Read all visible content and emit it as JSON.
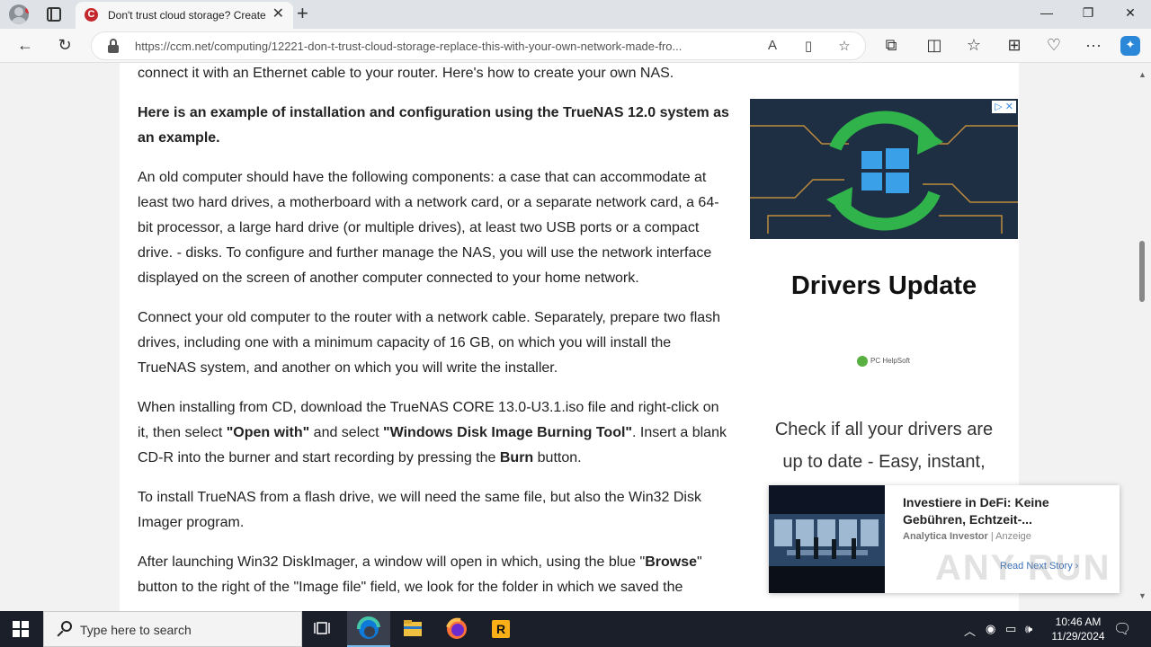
{
  "browser": {
    "tab_title": "Don't trust cloud storage? Create",
    "tab_favicon_letter": "C",
    "url": "https://ccm.net/computing/12221-don-t-trust-cloud-storage-replace-this-with-your-own-network-made-fro..."
  },
  "article": {
    "p0": "connect it with an Ethernet cable to your router. Here's how to create your own NAS.",
    "p1": "Here is an example of installation and configuration using the TrueNAS 12.0 system as an example.",
    "p2": "An old computer should have the following components: a case that can accommodate at least two hard drives, a motherboard with a network card, or a separate network card, a 64-bit processor, a large hard drive (or multiple drives), at least two USB ports or a compact drive. - disks. To configure and further manage the NAS, you will use the network interface displayed on the screen of another computer connected to your home network.",
    "p3": "Connect your old computer to the router with a network cable. Separately, prepare two flash drives, including one with a minimum capacity of 16 GB, on which you will install the TrueNAS system, and another on which you will write the installer.",
    "p4": {
      "a": "When installing from CD, download the TrueNAS CORE 13.0-U3.1.iso file and right-click on it, then select ",
      "b": "\"Open with\"",
      "c": " and select ",
      "d": "\"Windows Disk Image Burning Tool\"",
      "e": ". Insert a blank CD-R into the burner and start recording by pressing the ",
      "f": "Burn",
      "g": " button."
    },
    "p5": "To install TrueNAS from a flash drive, we will need the same file, but also the Win32 Disk Imager program.",
    "p6": {
      "a": "After launching Win32 DiskImager, a window will open in which, using the blue \"",
      "b": "Browse",
      "c": "\" button to the right of the \"Image file\" field, we look for the folder in which we saved the"
    }
  },
  "sidebar_ad": {
    "title": "Drivers Update",
    "brand": "PC HelpSoft",
    "text": "Check if all your drivers are up to date - Easy, instant,"
  },
  "story": {
    "headline": "Investiere in DeFi: Keine Gebühren, Echtzeit-...",
    "source": "Analytica Investor",
    "tag": "Anzeige",
    "read_more": "Read Next Story"
  },
  "watermark": "ANY RUN",
  "taskbar": {
    "search_placeholder": "Type here to search",
    "time": "10:46 AM",
    "date": "11/29/2024"
  },
  "colors": {
    "accent_edge": "#0078d4",
    "favicon": "#c4282d",
    "taskbar": "#1b1f2a"
  }
}
